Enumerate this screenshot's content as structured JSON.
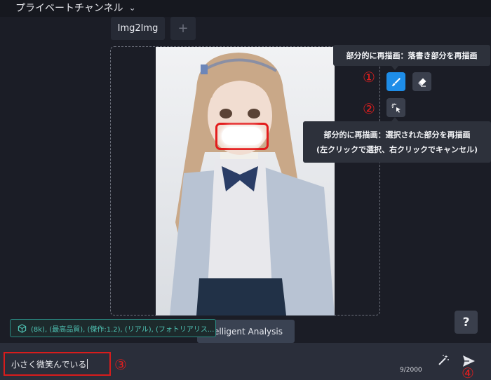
{
  "header": {
    "channel_title": "プライベートチャンネル",
    "chevron_icon": "chevron-down-icon"
  },
  "tabs": [
    {
      "label": "Img2Img"
    },
    {
      "label": "+"
    }
  ],
  "tooltips": {
    "brush": "部分的に再描画：落書き部分を再描画",
    "select_line1": "部分的に再描画：選択された部分を再描画",
    "select_line2": "(左クリックで選択、右クリックでキャンセル)"
  },
  "tools": {
    "brush_icon": "brush-icon",
    "eraser_icon": "eraser-icon",
    "select_icon": "magic-select-icon"
  },
  "annotations": {
    "n1": "①",
    "n2": "②",
    "n3": "③",
    "n4": "④"
  },
  "help": {
    "label": "?"
  },
  "analysis_button": {
    "label": "Intelligent Analysis"
  },
  "prompt_chip": {
    "text": "(8k), (最高品質), (傑作:1.2), (リアル), (フォトリアリス..."
  },
  "composer": {
    "value": "小さく微笑んでいる",
    "counter": "9/2000"
  },
  "colors": {
    "accent": "#1e8de8",
    "annotation_red": "#e01e1e",
    "chip_teal": "#4fc3b4"
  }
}
